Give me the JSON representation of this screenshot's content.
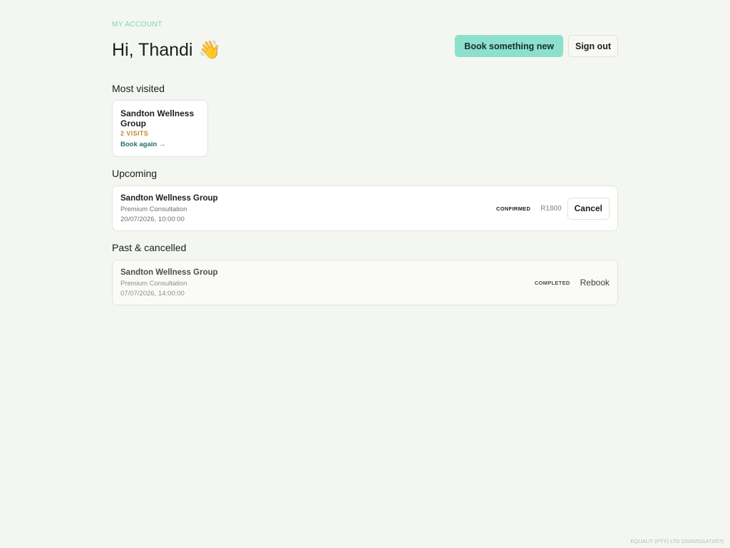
{
  "header": {
    "eyebrow": "MY ACCOUNT",
    "greeting": "Hi, Thandi",
    "greeting_emoji": "👋",
    "book_new_label": "Book something new",
    "sign_out_label": "Sign out"
  },
  "most_visited": {
    "title": "Most visited",
    "items": [
      {
        "name": "Sandton Wellness Group",
        "visits": "2 VISITS",
        "action": "Book again →"
      }
    ]
  },
  "upcoming": {
    "title": "Upcoming",
    "items": [
      {
        "name": "Sandton Wellness Group",
        "service": "Premium Consultation",
        "datetime": "20/07/2026, 10:00:00",
        "status": "CONFIRMED",
        "price": "R1800",
        "action": "Cancel"
      }
    ]
  },
  "past": {
    "title": "Past & cancelled",
    "items": [
      {
        "name": "Sandton Wellness Group",
        "service": "Premium Consultation",
        "datetime": "07/07/2026, 14:00:00",
        "status": "COMPLETED",
        "action": "Rebook"
      }
    ]
  },
  "footer": {
    "text": "EQUALIT (PTY) LTD (2026/531473/07)"
  },
  "colors": {
    "background": "#f4f6f1",
    "accent": "#8de0cc",
    "eyebrow": "#7fd4c0",
    "visits": "#c08a2a",
    "link": "#256f66"
  }
}
